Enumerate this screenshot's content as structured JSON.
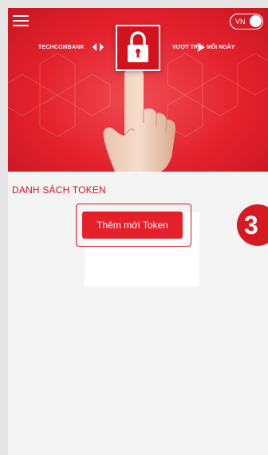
{
  "header": {
    "menu_icon": "hamburger-menu-icon",
    "language_label": "VN",
    "brand_name": "TECHCOMBANK",
    "slogan_part1": "VƯỢT TRỘI",
    "slogan_part2": "MỖI NGÀY",
    "banner_icon": "padlock-icon"
  },
  "main": {
    "section_title": "DANH SÁCH TOKEN",
    "add_token_label": "Thêm mới Token"
  },
  "annotation": {
    "step_number": "3"
  },
  "colors": {
    "brand_red": "#e4202c",
    "title_red": "#d3131f",
    "background": "#f4f4f4"
  }
}
